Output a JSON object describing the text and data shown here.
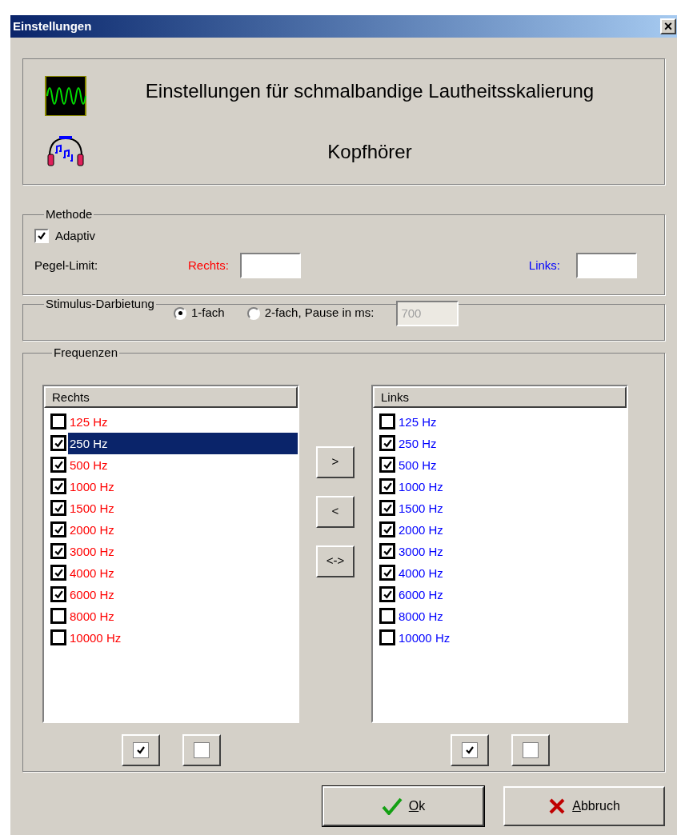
{
  "window": {
    "title": "Einstellungen",
    "close": "×"
  },
  "header": {
    "title": "Einstellungen für schmalbandige Lautheitsskalierung",
    "subtitle": "Kopfhörer"
  },
  "methode": {
    "legend": "Methode",
    "adaptive": {
      "label": "Adaptiv",
      "checked": true
    },
    "limit_label": "Pegel-Limit:",
    "right_label": "Rechts:",
    "left_label": "Links:"
  },
  "stimulus": {
    "legend": "Stimulus-Darbietung",
    "options": [
      {
        "label": "1-fach",
        "selected": true
      },
      {
        "label": "2-fach, Pause in ms:",
        "selected": false
      }
    ],
    "pause": {
      "value": "700",
      "disabled": true
    }
  },
  "frequenzen": {
    "legend": "Frequenzen",
    "lists": [
      {
        "color": "#ff0000",
        "header": "Rechts",
        "items": [
          {
            "label": "125 Hz",
            "checked": false,
            "selected": false
          },
          {
            "label": "250 Hz",
            "checked": true,
            "selected": true
          },
          {
            "label": "500 Hz",
            "checked": true,
            "selected": false
          },
          {
            "label": "1000 Hz",
            "checked": true,
            "selected": false
          },
          {
            "label": "1500 Hz",
            "checked": true,
            "selected": false
          },
          {
            "label": "2000 Hz",
            "checked": true,
            "selected": false
          },
          {
            "label": "3000 Hz",
            "checked": true,
            "selected": false
          },
          {
            "label": "4000 Hz",
            "checked": true,
            "selected": false
          },
          {
            "label": "6000 Hz",
            "checked": true,
            "selected": false
          },
          {
            "label": "8000 Hz",
            "checked": false,
            "selected": false
          },
          {
            "label": "10000 Hz",
            "checked": false,
            "selected": false
          }
        ]
      },
      {
        "color": "#0000ff",
        "header": "Links",
        "items": [
          {
            "label": "125 Hz",
            "checked": false,
            "selected": false
          },
          {
            "label": "250 Hz",
            "checked": true,
            "selected": false
          },
          {
            "label": "500 Hz",
            "checked": true,
            "selected": false
          },
          {
            "label": "1000 Hz",
            "checked": true,
            "selected": false
          },
          {
            "label": "1500 Hz",
            "checked": true,
            "selected": false
          },
          {
            "label": "2000 Hz",
            "checked": true,
            "selected": false
          },
          {
            "label": "3000 Hz",
            "checked": true,
            "selected": false
          },
          {
            "label": "4000 Hz",
            "checked": true,
            "selected": false
          },
          {
            "label": "6000 Hz",
            "checked": true,
            "selected": false
          },
          {
            "label": "8000 Hz",
            "checked": false,
            "selected": false
          },
          {
            "label": "10000 Hz",
            "checked": false,
            "selected": false
          }
        ]
      }
    ],
    "move_buttons": [
      ">",
      "<",
      "<->"
    ]
  },
  "buttons": [
    {
      "kind": "ok",
      "label": "Ok",
      "underline_first": true
    },
    {
      "kind": "cancel",
      "label": "Abbruch",
      "underline_first": true
    }
  ]
}
